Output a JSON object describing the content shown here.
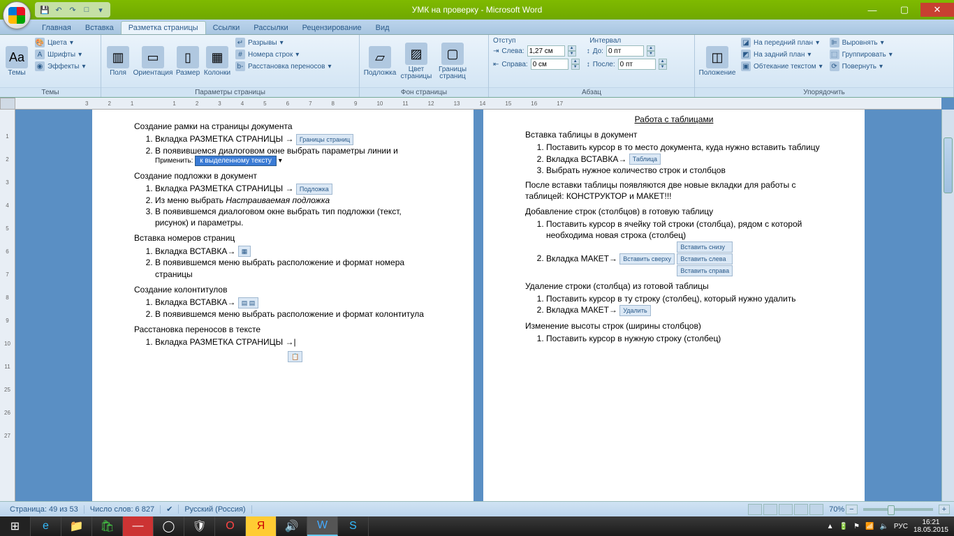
{
  "window": {
    "title": "УМК на проверку - Microsoft Word"
  },
  "tabs": {
    "home": "Главная",
    "insert": "Вставка",
    "layout": "Разметка страницы",
    "references": "Ссылки",
    "mailings": "Рассылки",
    "review": "Рецензирование",
    "view": "Вид"
  },
  "ribbon": {
    "themes": {
      "label": "Темы",
      "themes_btn": "Темы",
      "colors": "Цвета",
      "fonts": "Шрифты",
      "effects": "Эффекты"
    },
    "page_setup": {
      "label": "Параметры страницы",
      "margins": "Поля",
      "orientation": "Ориентация",
      "size": "Размер",
      "columns": "Колонки",
      "breaks": "Разрывы",
      "line_numbers": "Номера строк",
      "hyphenation": "Расстановка переносов"
    },
    "page_bg": {
      "label": "Фон страницы",
      "watermark": "Подложка",
      "page_color": "Цвет страницы",
      "borders": "Границы страниц"
    },
    "paragraph": {
      "label": "Абзац",
      "indent": "Отступ",
      "left": "Слева:",
      "right": "Справа:",
      "left_val": "1,27 см",
      "right_val": "0 см",
      "spacing": "Интервал",
      "before": "До:",
      "after": "После:",
      "before_val": "0 пт",
      "after_val": "0 пт"
    },
    "arrange": {
      "label": "Упорядочить",
      "position": "Положение",
      "front": "На передний план",
      "back": "На задний план",
      "wrap": "Обтекание текстом",
      "align": "Выровнять",
      "group": "Группировать",
      "rotate": "Повернуть"
    }
  },
  "doc": {
    "left": {
      "h1": "Создание рамки на страницы документа",
      "l1_1": "Вкладка  РАЗМЕТКА СТРАНИЦЫ →",
      "img1": "Границы страниц",
      "l1_2": "В появившемся диалоговом окне выбрать параметры линии и",
      "apply_label": "Применить:",
      "apply_val": "к выделенному тексту",
      "h2": "Создание подложки в документ",
      "l2_1": "Вкладка  РАЗМЕТКА СТРАНИЦЫ →",
      "img2": "Подложка",
      "l2_2_a": "Из меню выбрать ",
      "l2_2_b": "Настраиваемая подложка",
      "l2_3": "В появившемся диалоговом окне выбрать тип подложки (текст, рисунок) и параметры.",
      "h3": "Вставка номеров страниц",
      "l3_1": "Вкладка ВСТАВКА→",
      "l3_2": "В появившемся меню выбрать расположение и формат номера страницы",
      "h4": "Создание колонтитулов",
      "l4_1": "Вкладка ВСТАВКА→",
      "l4_2": "В появившемся меню выбрать расположение и формат колонтитула",
      "h5": "Расстановка переносов в тексте",
      "l5_1": "Вкладка  РАЗМЕТКА СТРАНИЦЫ →|"
    },
    "right": {
      "title": "Работа с таблицами",
      "h1": "Вставка таблицы в документ",
      "r1_1": "Поставить курсор в то место документа, куда нужно вставить таблицу",
      "r1_2": "Вкладка ВСТАВКА→",
      "img_table": "Таблица",
      "r1_3": "Выбрать нужное количество строк и столбцов",
      "after1": "После вставки таблицы появляются две новые вкладки для работы с таблицей: КОНСТРУКТОР и МАКЕТ!!!",
      "h2": "Добавление строк (столбцов) в готовую таблицу",
      "r2_1": "Поставить курсор в ячейку той строки (столбца), рядом с которой необходима новая строка (столбец)",
      "r2_2": "Вкладка МАКЕТ→",
      "ins_top": "Вставить сверху",
      "ins_bottom": "Вставить снизу",
      "ins_left": "Вставить слева",
      "ins_right": "Вставить справа",
      "h3": "Удаление строки (столбца) из готовой таблицы",
      "r3_1": "Поставить курсор в ту строку (столбец), который нужно удалить",
      "r3_2": "Вкладка МАКЕТ→",
      "img_del": "Удалить",
      "h4": "Изменение высоты строк (ширины столбцов)",
      "r4_1": "Поставить курсор в нужную строку (столбец)"
    }
  },
  "status": {
    "page": "Страница: 49 из 53",
    "words": "Число слов: 6 827",
    "lang": "Русский (Россия)",
    "zoom": "70%"
  },
  "tray": {
    "lang": "РУС",
    "time": "16:21",
    "date": "18.05.2015"
  },
  "ruler_h": [
    "3",
    "2",
    "1",
    "",
    "1",
    "2",
    "3",
    "4",
    "5",
    "6",
    "7",
    "8",
    "9",
    "10",
    "11",
    "12",
    "13",
    "14",
    "15",
    "16",
    "17"
  ],
  "ruler_v": [
    "",
    "1",
    "2",
    "3",
    "4",
    "5",
    "6",
    "7",
    "8",
    "9",
    "10",
    "11",
    "25",
    "26",
    "27"
  ]
}
